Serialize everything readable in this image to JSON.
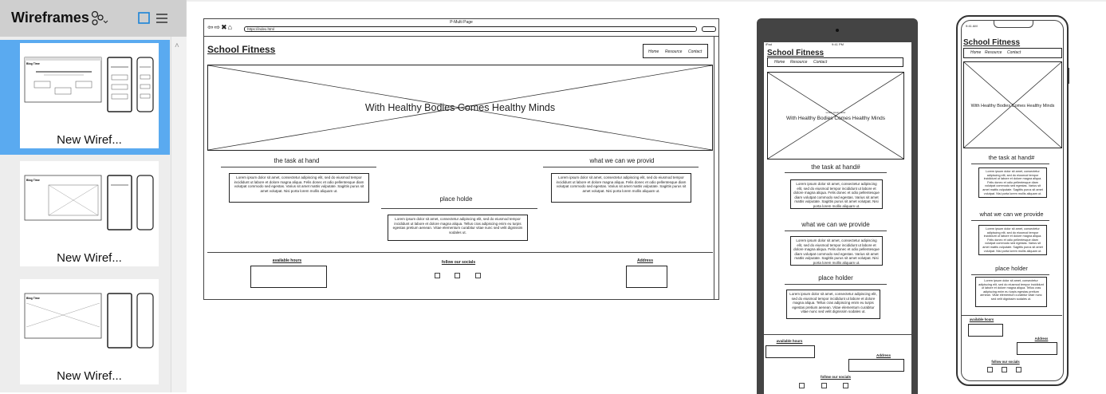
{
  "panel": {
    "title": "Wireframes",
    "thumbnails": [
      {
        "label": "New Wiref..."
      },
      {
        "label": "New Wiref..."
      },
      {
        "label": "New Wiref..."
      }
    ]
  },
  "desktop": {
    "window_title": "P-Multi Page",
    "url": "https://index.html",
    "site_title": "School Fitness",
    "nav": [
      "Home",
      "Resource",
      "Contact"
    ],
    "hero_text": "With Healthy Bodies Comes Healthy Minds",
    "section_left": "the task at hand",
    "section_right": "what we can we provid",
    "section_center": "place holde",
    "lorem": "Lorem ipsum dolor sit amet, consectetur adipiscing elit, sed do eiusmod tempor incididunt ut labore et dolore magna aliqua. Felis donec et odio pellentesque diam volutpat commodo sed egestas. Varius sit amet mattis vulputate. Sagittis purus sit amet volutpat. Nisi porta lorem mollis aliquam ut.",
    "lorem_short": "Lorem ipsum dolor sit amet, consectetur adipiscing elit, sed do eiusmod tempor incididunt ut labore et dolore magna aliqua. Tellus cras adipiscing enim eu turpis egestas pretium aenean. Vitae elementum curabitur vitae nunc sed velit dignissim sodales ut.",
    "footer_hours": "available hours",
    "footer_socials": "follow our socials",
    "footer_address": "Address"
  },
  "tablet": {
    "status_left": "iPad",
    "status_time": "9:41 PM",
    "site_title": "School Fitness",
    "nav": [
      "Home",
      "Resource",
      "Contact"
    ],
    "hero_small": "Lorem ipsum dolor",
    "hero_text": "With Healthy Bodies Comes Healthy Minds",
    "section1": "the task at hand#",
    "section2": "what we can we provide",
    "section3": "place holder",
    "footer_hours": "available hours",
    "footer_address": "Address",
    "footer_socials": "follow our socials"
  },
  "phone": {
    "status_time": "9:41 AM",
    "site_title": "School Fitness",
    "nav": [
      "Home",
      "Resource",
      "Contact"
    ],
    "hero_text": "With Healthy Bodies Comes Healthy Minds",
    "section1": "the task at hand#",
    "section2": "what we can we provide",
    "section3": "place holder",
    "footer_hours": "available hours",
    "footer_address": "Address",
    "footer_socials": "follow our socials"
  },
  "colors": {
    "selected": "#5aaaf0",
    "header": "#cfcfcf",
    "panel": "#ededed"
  }
}
